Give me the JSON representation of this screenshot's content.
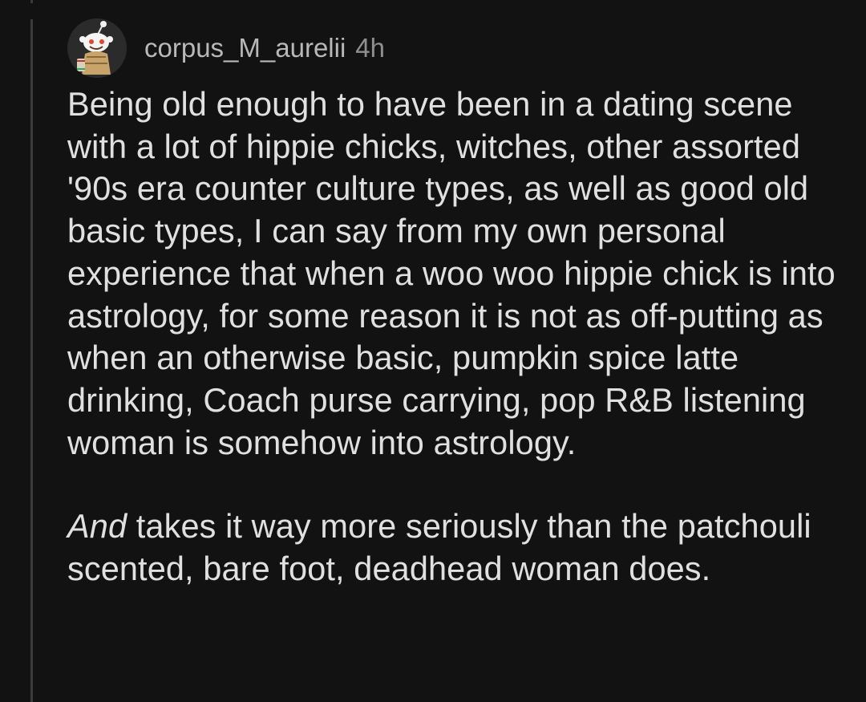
{
  "comment": {
    "author": "corpus_M_aurelii",
    "age": "4h",
    "avatar_icon": "snoo-avatar-icon",
    "paragraph_1": "Being old enough to have been in a dating scene with a lot of hippie chicks, witches, other assorted '90s era counter culture types, as well as good old basic types, I can say from my own personal experience that when a woo woo hippie chick is into astrology, for some reason it is not as off-putting as when an otherwise basic, pumpkin spice latte drinking, Coach purse carrying, pop R&B listening woman is somehow into astrology.",
    "paragraph_2_emphasis": "And",
    "paragraph_2_rest": " takes it way more seriously than the patchouli scented, bare foot, deadhead woman does."
  },
  "colors": {
    "background": "#121212",
    "thread_line": "#3a3a3a",
    "body_text": "#e0e0e0",
    "username": "#b8b8b8",
    "timestamp": "#8f8f8f"
  }
}
